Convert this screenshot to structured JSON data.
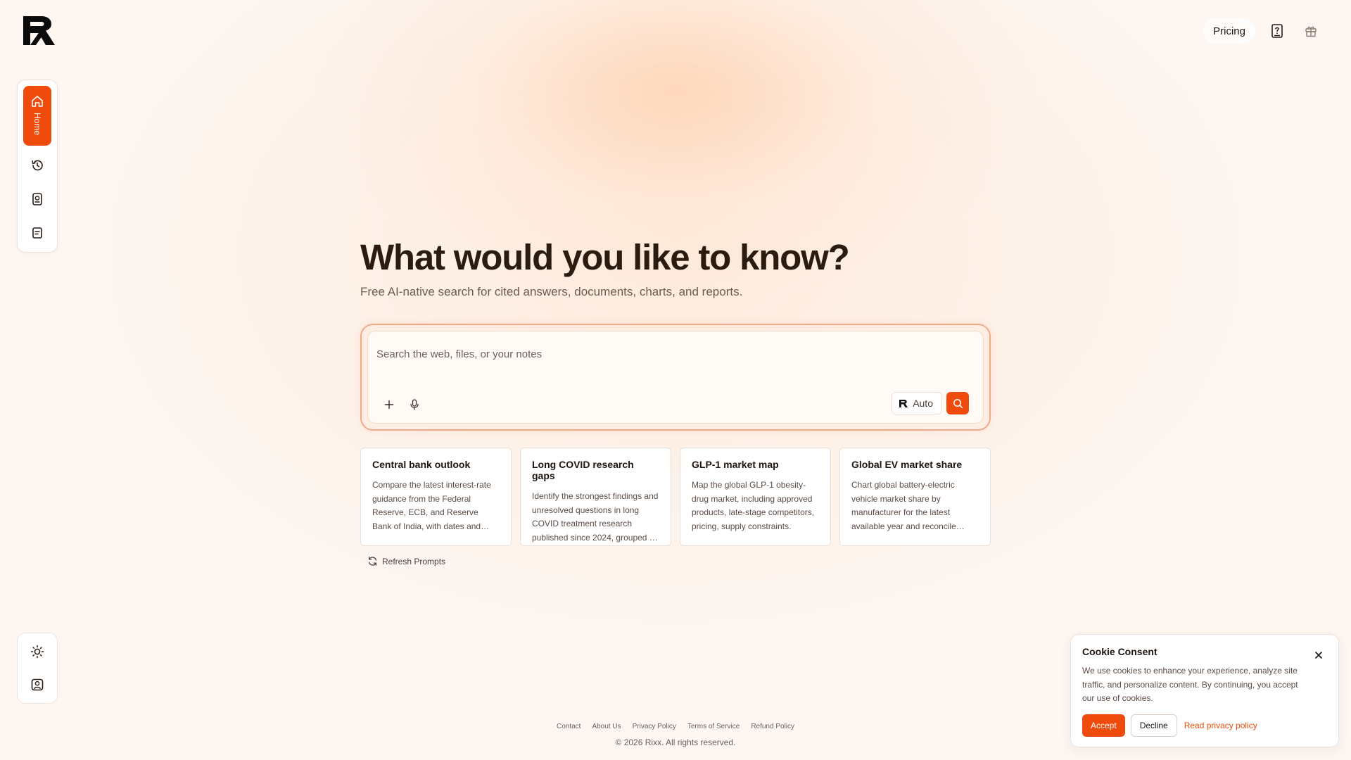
{
  "brand": {
    "logo_icon": "rixx-logo",
    "accent": "#ee4b0c"
  },
  "header": {
    "pricing_label": "Pricing",
    "icons": [
      "help-book-icon",
      "gift-icon"
    ]
  },
  "sidebar": {
    "home_label": "Home",
    "items": [
      "home-icon",
      "history-icon",
      "library-icon",
      "notes-icon"
    ],
    "bottom_items": [
      "theme-sun-icon",
      "account-icon"
    ]
  },
  "hero": {
    "title": "What would you like to know?",
    "subtitle": "Free AI-native search for cited answers, documents, charts, and reports."
  },
  "search": {
    "placeholder": "Search the web, files, or your notes",
    "mode_label": "Auto"
  },
  "prompts": [
    {
      "title": "Central bank outlook",
      "desc": "Compare the latest interest-rate guidance from the Federal Reserve, ECB, and Reserve Bank of India, with dates and sources."
    },
    {
      "title": "Long COVID research gaps",
      "desc": "Identify the strongest findings and unresolved questions in long COVID treatment research published since 2024, grouped by theme."
    },
    {
      "title": "GLP-1 market map",
      "desc": "Map the global GLP-1 obesity-drug market, including approved products, late-stage competitors, pricing, supply constraints."
    },
    {
      "title": "Global EV market share",
      "desc": "Chart global battery-electric vehicle market share by manufacturer for the latest available year and reconcile sources."
    }
  ],
  "refresh_label": "Refresh Prompts",
  "footer": {
    "links": [
      "Contact",
      "About Us",
      "Privacy Policy",
      "Terms of Service",
      "Refund Policy"
    ],
    "copyright": "© 2026 Rixx. All rights reserved."
  },
  "cookie": {
    "title": "Cookie Consent",
    "text": "We use cookies to enhance your experience, analyze site traffic, and personalize content. By continuing, you accept our use of cookies.",
    "accept_label": "Accept",
    "decline_label": "Decline",
    "privacy_label": "Read privacy policy"
  }
}
